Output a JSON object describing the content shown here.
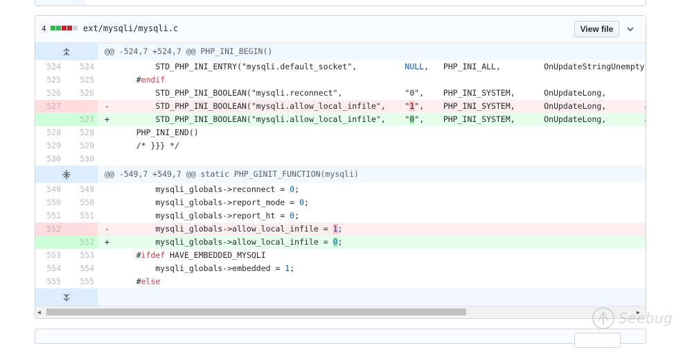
{
  "file": {
    "change_count": "4",
    "path": "ext/mysqli/mysqli.c",
    "view_button": "View file",
    "stat_colors": [
      "#2cbe4e",
      "#2cbe4e",
      "#cb2431",
      "#cb2431",
      "#d1d5da"
    ]
  },
  "hunks": [
    {
      "header": "@@ -524,7 +524,7 @@ PHP_INI_BEGIN()"
    },
    {
      "header": "@@ -549,7 +549,7 @@ static PHP_GINIT_FUNCTION(mysqli)"
    }
  ],
  "lines1": [
    {
      "old": "524",
      "new": "524"
    },
    {
      "old": "525",
      "new": "525"
    },
    {
      "old": "526",
      "new": "526"
    },
    {
      "old": "527",
      "new": ""
    },
    {
      "old": "",
      "new": "527"
    },
    {
      "old": "528",
      "new": "528"
    },
    {
      "old": "529",
      "new": "529"
    },
    {
      "old": "530",
      "new": "530"
    }
  ],
  "lines2": [
    {
      "old": "549",
      "new": "549"
    },
    {
      "old": "550",
      "new": "550"
    },
    {
      "old": "551",
      "new": "551"
    },
    {
      "old": "552",
      "new": ""
    },
    {
      "old": "",
      "new": "552"
    },
    {
      "old": "553",
      "new": "553"
    },
    {
      "old": "554",
      "new": "554"
    },
    {
      "old": "555",
      "new": "555"
    }
  ],
  "code": {
    "l524_a": "        STD_PHP_INI_ENTRY(\"mysqli.default_socket\",          ",
    "l524_b": "NULL",
    "l524_c": ",   PHP_INI_ALL,         OnUpdateStringUnempty,  default_",
    "l525_a": "#",
    "l525_b": "endif",
    "l526_a": "        STD_PHP_INI_BOOLEAN(\"mysqli.reconnect\",             \"0\",    PHP_INI_SYSTEM,      OnUpdateLong,        reconnect,",
    "l527d_sign": "-",
    "l527d_a": "        STD_PHP_INI_BOOLEAN(\"mysqli.allow_local_infile\",    \"",
    "l527d_b": "1",
    "l527d_c": "\",    PHP_INI_SYSTEM,      OnUpdateLong,        allow_local_",
    "l527a_sign": "+",
    "l527a_a": "        STD_PHP_INI_BOOLEAN(\"mysqli.allow_local_infile\",    \"",
    "l527a_b": "0",
    "l527a_c": "\",    PHP_INI_SYSTEM,      OnUpdateLong,        allow_local_",
    "l528": "    PHP_INI_END()",
    "l529": "    /* }}} */",
    "l549_a": "        mysqli_globals->reconnect = ",
    "l549_b": "0",
    "l549_c": ";",
    "l550_a": "        mysqli_globals->report_mode = ",
    "l550_b": "0",
    "l550_c": ";",
    "l551_a": "        mysqli_globals->report_ht = ",
    "l551_b": "0",
    "l551_c": ";",
    "l552d_sign": "-",
    "l552d_a": "        mysqli_globals->allow_local_infile = ",
    "l552d_b": "1",
    "l552d_c": ";",
    "l552a_sign": "+",
    "l552a_a": "        mysqli_globals->allow_local_infile = ",
    "l552a_b": "0",
    "l552a_c": ";",
    "l553_a": "    #",
    "l553_b": "ifdef",
    "l553_c": " HAVE_EMBEDDED_MYSQLI",
    "l554_a": "        mysqli_globals->embedded = ",
    "l554_b": "1",
    "l554_c": ";",
    "l555_a": "    #",
    "l555_b": "else"
  },
  "watermark": {
    "text": "Seebug"
  }
}
